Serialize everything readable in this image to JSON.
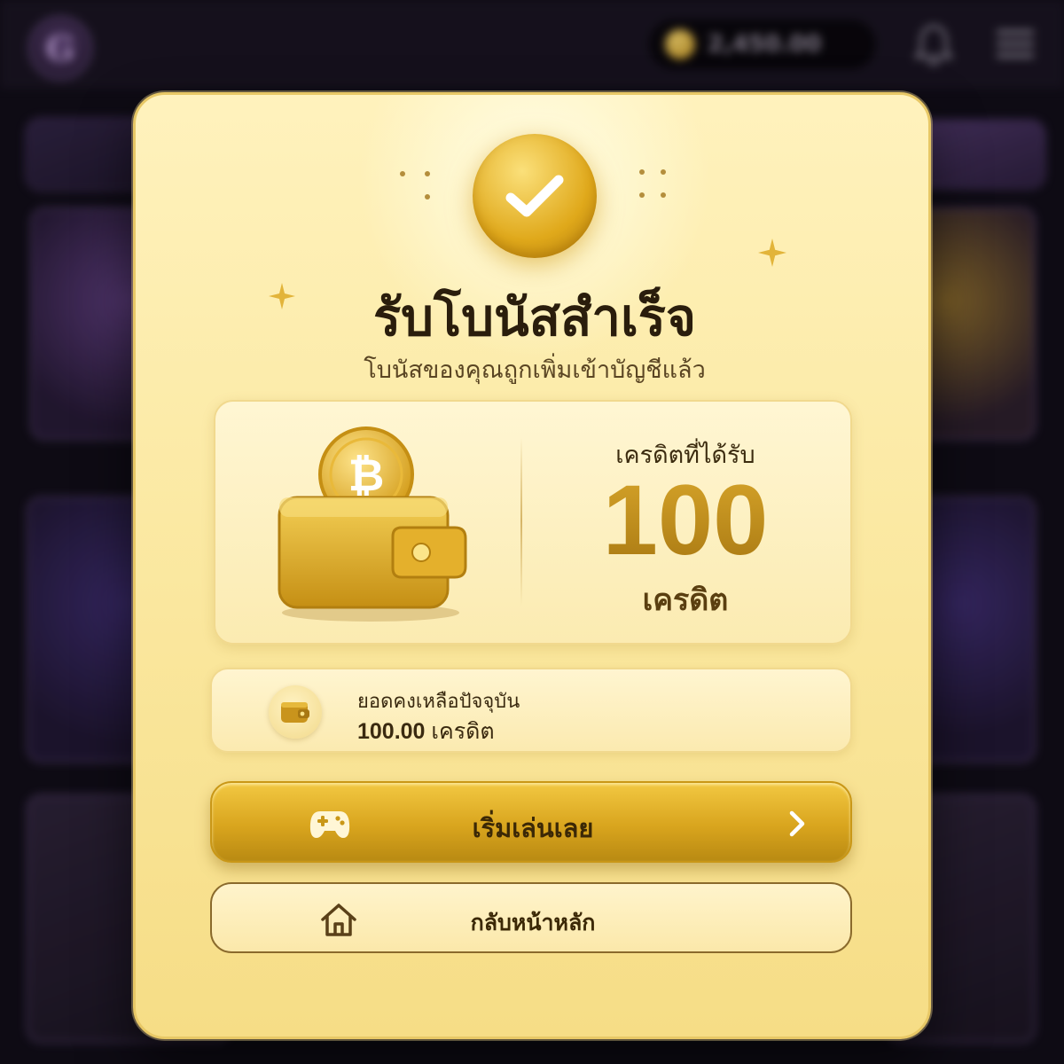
{
  "background": {
    "logo_letter": "G",
    "balance": "2,450.00"
  },
  "modal": {
    "title": "รับโบนัสสำเร็จ",
    "subtitle": "โบนัสของคุณถูกเพิ่มเข้าบัญชีแล้ว",
    "credit": {
      "label": "เครดิตที่ได้รับ",
      "amount": "100",
      "unit": "เครดิต"
    },
    "balance": {
      "label": "ยอดคงเหลือปัจจุบัน",
      "value": "100.00",
      "unit": "เครดิต"
    },
    "primary_button": {
      "label": "เริ่มเล่นเลย",
      "icon": "gamepad-icon"
    },
    "secondary_button": {
      "label": "กลับหน้าหลัก",
      "icon": "home-icon"
    }
  },
  "colors": {
    "accent_gold": "#d9a51e",
    "modal_bg": "#fbe9a3",
    "dark_bg": "#0e0b14"
  }
}
